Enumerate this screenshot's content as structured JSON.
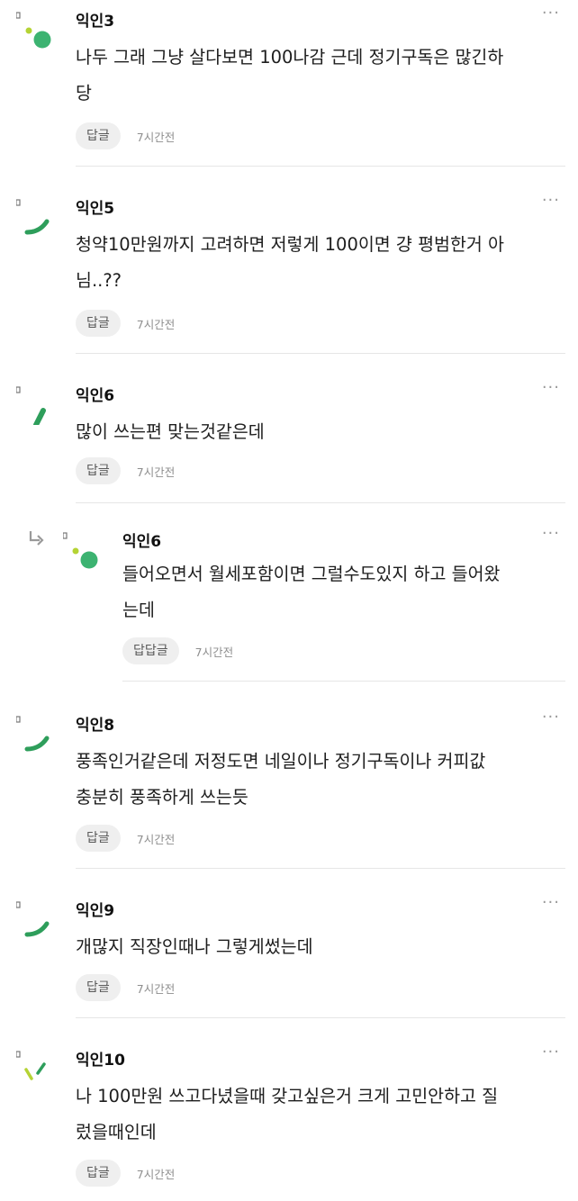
{
  "comments": [
    {
      "nick": "익인3",
      "text": "나두 그래 그냥 살다보면 100나감 근데 정기구독은 많긴하\n당",
      "reply_label": "답글",
      "time": "7시간전",
      "more": "···"
    },
    {
      "nick": "익인5",
      "text": "청약10만원까지 고려하면 저렇게 100이면 걍 평범한거 아\n님..??",
      "reply_label": "답글",
      "time": "7시간전",
      "more": "···"
    },
    {
      "nick": "익인6",
      "text": "많이 쓰는편 맞는것같은데",
      "reply_label": "답글",
      "time": "7시간전",
      "more": "···"
    },
    {
      "nick": "익인6",
      "text": "들어오면서 월세포함이면 그럴수도있지 하고 들어왔\n는데",
      "reply_label": "답답글",
      "time": "7시간전",
      "more": "···"
    },
    {
      "nick": "익인8",
      "text": "풍족인거같은데 저정도면 네일이나 정기구독이나 커피값\n충분히 풍족하게 쓰는듯",
      "reply_label": "답글",
      "time": "7시간전",
      "more": "···"
    },
    {
      "nick": "익인9",
      "text": "개많지 직장인때나 그렇게썼는데",
      "reply_label": "답글",
      "time": "7시간전",
      "more": "···"
    },
    {
      "nick": "익인10",
      "text": "나 100만원 쓰고다녔을때 갖고싶은거 크게 고민안하고 질\n렀을때인데",
      "reply_label": "답글",
      "time": "7시간전",
      "more": "···"
    }
  ],
  "colors": {
    "green": "#3cb371",
    "avatar_dark": "#2e9e5b",
    "lime": "#b5d334",
    "accent": "#34b36b"
  }
}
